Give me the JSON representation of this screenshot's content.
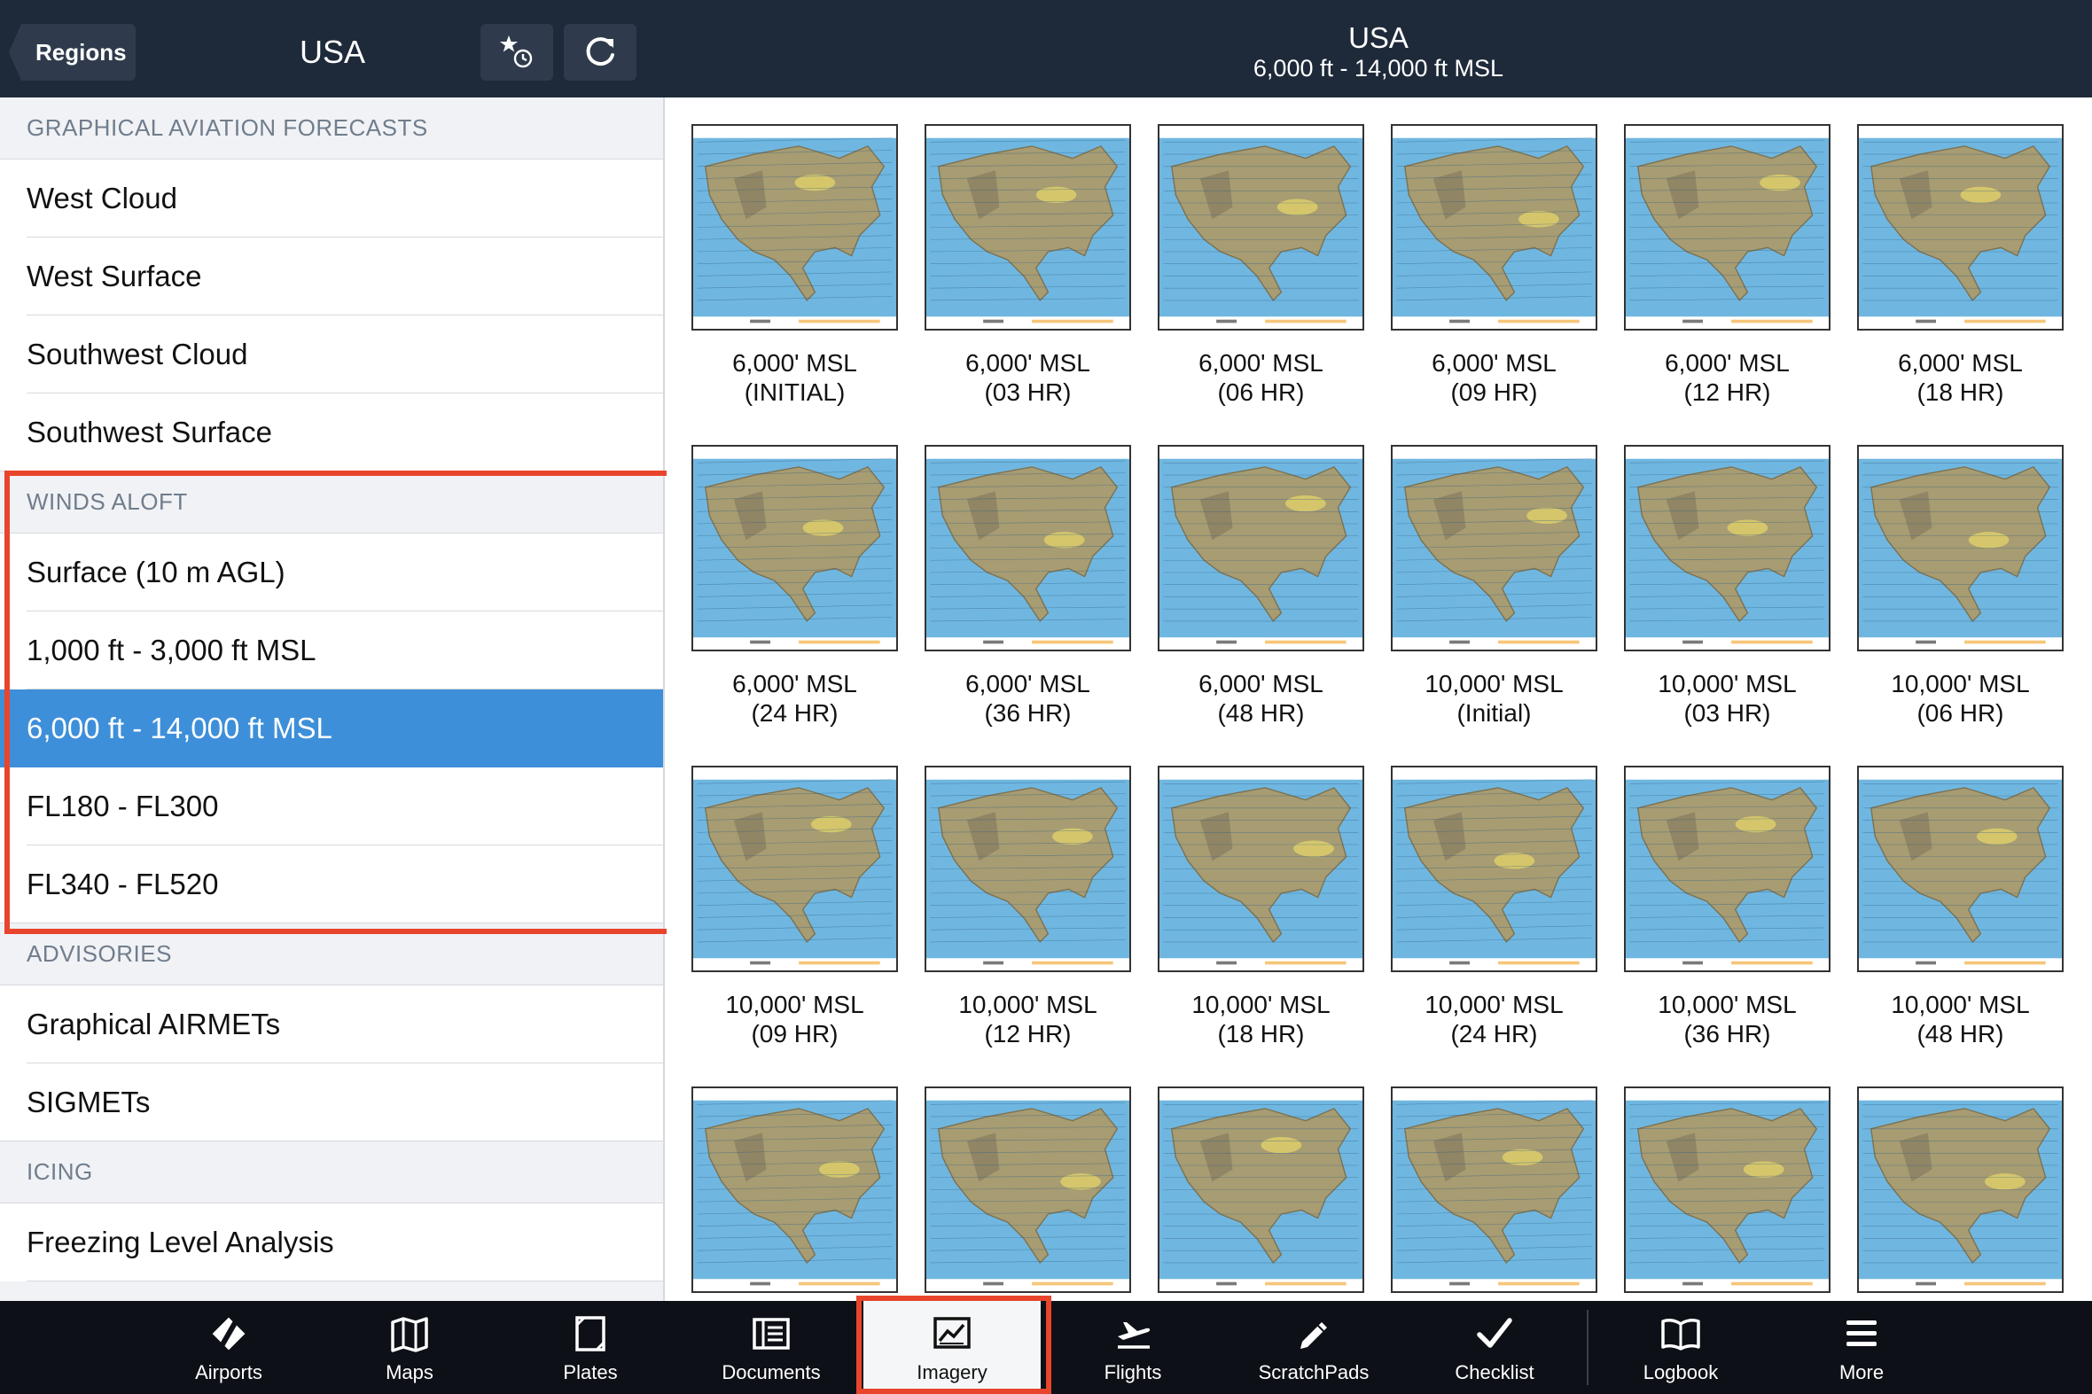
{
  "header": {
    "back_label": "Regions",
    "region_title": "USA",
    "favorites_icon": "star-clock-icon",
    "refresh_icon": "refresh-icon",
    "content_title": "USA",
    "content_subtitle": "6,000 ft - 14,000 ft MSL"
  },
  "sidebar": {
    "sections": [
      {
        "title": "GRAPHICAL AVIATION FORECASTS",
        "items": [
          "West Cloud",
          "West Surface",
          "Southwest Cloud",
          "Southwest Surface"
        ]
      },
      {
        "title": "WINDS ALOFT",
        "items": [
          "Surface (10 m AGL)",
          "1,000 ft - 3,000 ft MSL",
          "6,000 ft - 14,000 ft MSL",
          "FL180 - FL300",
          "FL340 - FL520"
        ],
        "selected_index": 2
      },
      {
        "title": "ADVISORIES",
        "items": [
          "Graphical AIRMETs",
          "SIGMETs"
        ]
      },
      {
        "title": "ICING",
        "items": [
          "Freezing Level Analysis"
        ]
      }
    ]
  },
  "grid": {
    "tiles": [
      {
        "line1": "6,000' MSL",
        "line2": "(INITIAL)"
      },
      {
        "line1": "6,000' MSL",
        "line2": "(03 HR)"
      },
      {
        "line1": "6,000' MSL",
        "line2": "(06 HR)"
      },
      {
        "line1": "6,000' MSL",
        "line2": "(09 HR)"
      },
      {
        "line1": "6,000' MSL",
        "line2": "(12 HR)"
      },
      {
        "line1": "6,000' MSL",
        "line2": "(18 HR)"
      },
      {
        "line1": "6,000' MSL",
        "line2": "(24 HR)"
      },
      {
        "line1": "6,000' MSL",
        "line2": "(36 HR)"
      },
      {
        "line1": "6,000' MSL",
        "line2": "(48 HR)"
      },
      {
        "line1": "10,000' MSL",
        "line2": "(Initial)"
      },
      {
        "line1": "10,000' MSL",
        "line2": "(03 HR)"
      },
      {
        "line1": "10,000' MSL",
        "line2": "(06 HR)"
      },
      {
        "line1": "10,000' MSL",
        "line2": "(09 HR)"
      },
      {
        "line1": "10,000' MSL",
        "line2": "(12 HR)"
      },
      {
        "line1": "10,000' MSL",
        "line2": "(18 HR)"
      },
      {
        "line1": "10,000' MSL",
        "line2": "(24 HR)"
      },
      {
        "line1": "10,000' MSL",
        "line2": "(36 HR)"
      },
      {
        "line1": "10,000' MSL",
        "line2": "(48 HR)"
      },
      {
        "line1": "",
        "line2": ""
      },
      {
        "line1": "",
        "line2": ""
      },
      {
        "line1": "",
        "line2": ""
      },
      {
        "line1": "",
        "line2": ""
      },
      {
        "line1": "",
        "line2": ""
      },
      {
        "line1": "",
        "line2": ""
      }
    ]
  },
  "tabbar": {
    "tabs": [
      {
        "label": "Airports",
        "icon": "airports-icon"
      },
      {
        "label": "Maps",
        "icon": "maps-icon"
      },
      {
        "label": "Plates",
        "icon": "plates-icon"
      },
      {
        "label": "Documents",
        "icon": "documents-icon"
      },
      {
        "label": "Imagery",
        "icon": "imagery-icon",
        "active": true
      },
      {
        "label": "Flights",
        "icon": "flights-icon"
      },
      {
        "label": "ScratchPads",
        "icon": "scratchpads-icon"
      },
      {
        "label": "Checklist",
        "icon": "checklist-icon"
      },
      {
        "label": "Logbook",
        "icon": "logbook-icon"
      },
      {
        "label": "More",
        "icon": "more-icon"
      }
    ]
  },
  "colors": {
    "header_bg": "#1e2a3a",
    "selected_row": "#3d8fda",
    "highlight_border": "#e8452c",
    "tabbar_bg": "#0d1016",
    "ocean": "#6fb7e0",
    "land": "#a79c72"
  }
}
